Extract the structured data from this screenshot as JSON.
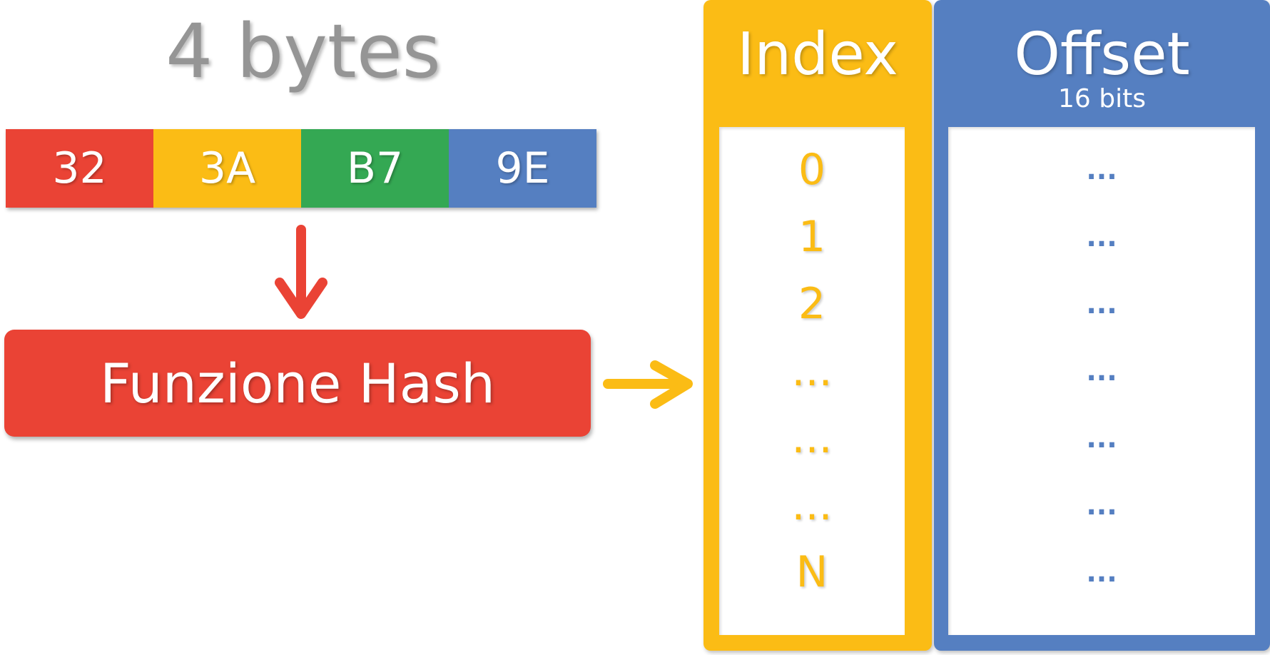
{
  "title": "4 bytes",
  "bytes": [
    {
      "label": "32",
      "color": "#EA4335"
    },
    {
      "label": "3A",
      "color": "#FBBC15"
    },
    {
      "label": "B7",
      "color": "#34A853"
    },
    {
      "label": "9E",
      "color": "#557FC1"
    }
  ],
  "hash_function": {
    "label": "Funzione Hash",
    "color": "#EA4335"
  },
  "index_column": {
    "header": "Index",
    "color": "#FBBC15",
    "rows": [
      "0",
      "1",
      "2",
      "...",
      "...",
      "...",
      "N"
    ]
  },
  "offset_column": {
    "header": "Offset",
    "subheader": "16 bits",
    "color": "#557FC1",
    "rows": [
      "...",
      "...",
      "...",
      "...",
      "...",
      "...",
      "..."
    ]
  },
  "arrows": {
    "down_color": "#EA4335",
    "right_color": "#FBBC15"
  }
}
